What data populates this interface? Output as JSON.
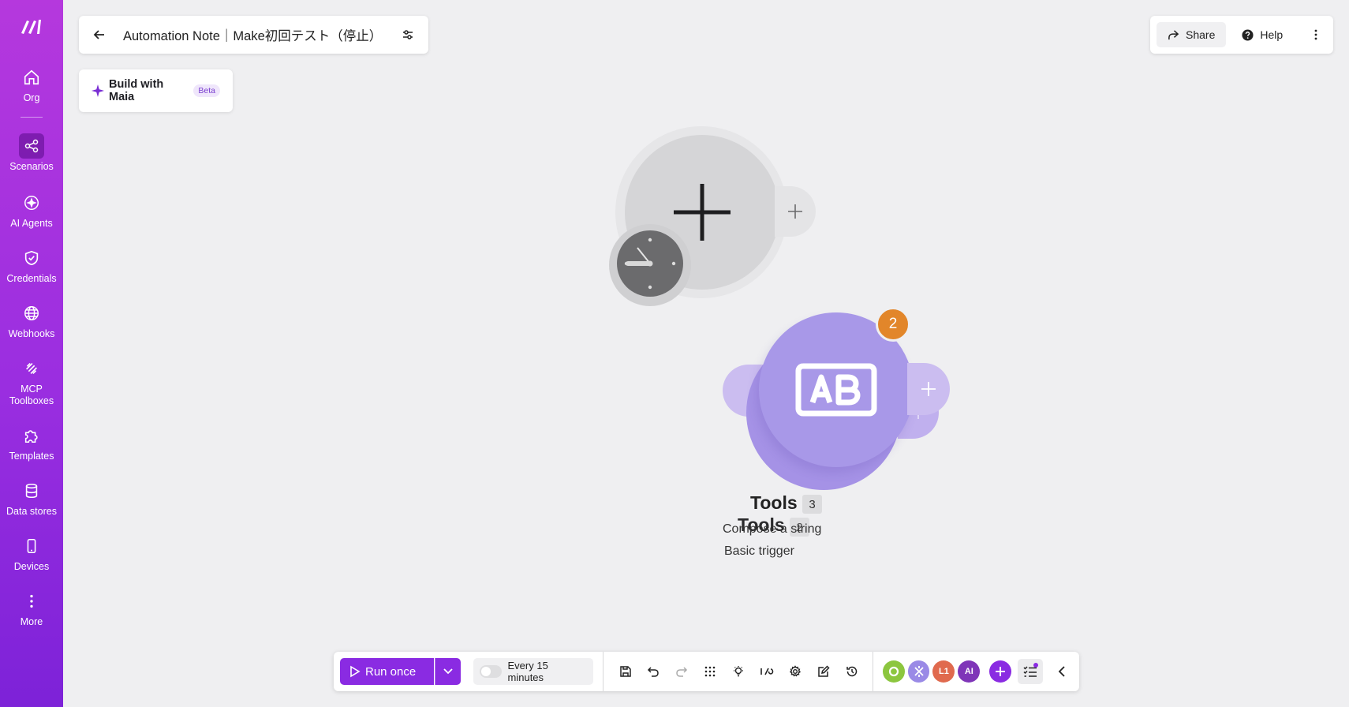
{
  "sidebar": {
    "items": [
      {
        "label": "Org",
        "icon": "home-icon"
      },
      {
        "label": "Scenarios",
        "icon": "share-nodes-icon"
      },
      {
        "label": "AI Agents",
        "icon": "ai-agent-icon"
      },
      {
        "label": "Credentials",
        "icon": "shield-check-icon"
      },
      {
        "label": "Webhooks",
        "icon": "globe-icon"
      },
      {
        "label": "MCP Toolboxes",
        "icon": "toolbox-icon"
      },
      {
        "label": "Templates",
        "icon": "puzzle-icon"
      },
      {
        "label": "Data stores",
        "icon": "database-icon"
      },
      {
        "label": "Devices",
        "icon": "mobile-icon"
      },
      {
        "label": "More",
        "icon": "more-vertical-icon"
      }
    ],
    "active": "Scenarios"
  },
  "header": {
    "title": "Automation Note｜Make初回テスト（停止）"
  },
  "maia": {
    "label": "Build with Maia",
    "badge": "Beta"
  },
  "topright": {
    "share_label": "Share",
    "help_label": "Help"
  },
  "canvas": {
    "module_count_badge": "2",
    "modules": [
      {
        "app": "Tools",
        "number": "3",
        "action": "Compose a string"
      },
      {
        "app": "Tools",
        "number": "2",
        "action": "Basic trigger"
      }
    ]
  },
  "toolbar": {
    "run_label": "Run once",
    "schedule_label": "Every 15 minutes",
    "apps": [
      {
        "label": "",
        "color": "#8cc63f"
      },
      {
        "label": "",
        "color": "#9a8ae6"
      },
      {
        "label": "L1",
        "color": "#e06a4e"
      },
      {
        "label": "AI",
        "color": "#7f35b8"
      }
    ]
  },
  "colors": {
    "brand": "#8a2be2",
    "badge": "#e2862a",
    "tools_module": "#a898e8"
  }
}
